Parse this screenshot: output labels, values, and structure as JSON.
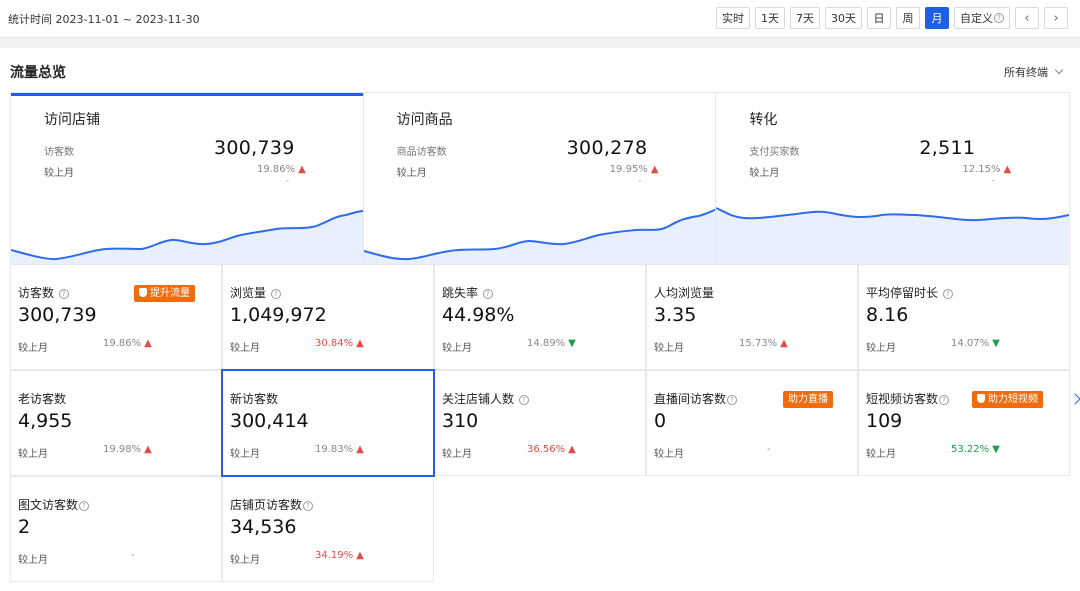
{
  "topbar": {
    "range_label": "统计时间",
    "range_value": "2023-11-01 ~ 2023-11-30",
    "periods": [
      "实时",
      "1天",
      "7天",
      "30天",
      "日",
      "周",
      "月",
      "自定义"
    ],
    "active_period": "月",
    "prev_icon": "chevron-left-icon",
    "next_icon": "chevron-right-icon"
  },
  "panel": {
    "title": "流量总览",
    "terminal": "所有终端"
  },
  "summary": [
    {
      "title": "访问店铺",
      "label": "访客数",
      "value": "300,739",
      "compare": "较上月",
      "pct": "19.86%",
      "trend": "up",
      "dash": "-"
    },
    {
      "title": "访问商品",
      "label": "商品访客数",
      "value": "300,278",
      "compare": "较上月",
      "pct": "19.95%",
      "trend": "up",
      "dash": "-"
    },
    {
      "title": "转化",
      "label": "支付买家数",
      "value": "2,511",
      "compare": "较上月",
      "pct": "12.15%",
      "trend": "up",
      "dash": "-"
    }
  ],
  "metrics": [
    {
      "label": "访客数",
      "value": "300,739",
      "compare": "较上月",
      "pct": "19.86%",
      "trend": "up",
      "badge": "提升流量"
    },
    {
      "label": "浏览量",
      "value": "1,049,972",
      "compare": "较上月",
      "pct": "30.84%",
      "trend": "up"
    },
    {
      "label": "跳失率",
      "value": "44.98%",
      "compare": "较上月",
      "pct": "14.89%",
      "trend": "down"
    },
    {
      "label": "人均浏览量",
      "value": "3.35",
      "compare": "较上月",
      "pct": "15.73%",
      "trend": "up"
    },
    {
      "label": "平均停留时长",
      "value": "8.16",
      "compare": "较上月",
      "pct": "14.07%",
      "trend": "down"
    },
    {
      "label": "老访客数",
      "value": "4,955",
      "compare": "较上月",
      "pct": "19.98%",
      "trend": "up"
    },
    {
      "label": "新访客数",
      "value": "300,414",
      "compare": "较上月",
      "pct": "19.83%",
      "trend": "up",
      "selected": true
    },
    {
      "label": "关注店铺人数",
      "value": "310",
      "compare": "较上月",
      "pct": "36.56%",
      "trend": "up"
    },
    {
      "label": "直播间访客数",
      "value": "0",
      "compare": "较上月",
      "pct": "-",
      "trend": "none",
      "badge": "助力直播"
    },
    {
      "label": "短视频访客数",
      "value": "109",
      "compare": "较上月",
      "pct": "53.22%",
      "trend": "down",
      "badge": "助力短视频"
    },
    {
      "label": "图文访客数",
      "value": "2",
      "compare": "较上月",
      "pct": "-",
      "trend": "none"
    },
    {
      "label": "店铺页访客数",
      "value": "34,536",
      "compare": "较上月",
      "pct": "34.19%",
      "trend": "up"
    }
  ]
}
